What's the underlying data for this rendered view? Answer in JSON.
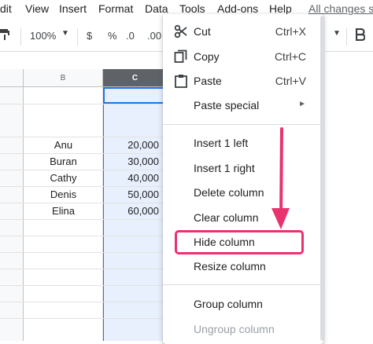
{
  "menubar": {
    "items": [
      "dit",
      "View",
      "Insert",
      "Format",
      "Data",
      "Tools",
      "Add-ons",
      "Help"
    ],
    "changes": "All changes s"
  },
  "toolbar": {
    "zoom": "100%",
    "currency": "$",
    "percent": "%",
    "dec_less": ".0",
    "dec_more": ".00"
  },
  "grid": {
    "columns": [
      "B",
      "C"
    ],
    "rows": [
      {
        "name": "Anu",
        "value": "20,000"
      },
      {
        "name": "Buran",
        "value": "30,000"
      },
      {
        "name": "Cathy",
        "value": "40,000"
      },
      {
        "name": "Denis",
        "value": "50,000"
      },
      {
        "name": "Elina",
        "value": "60,000"
      }
    ]
  },
  "context_menu": {
    "cut": {
      "label": "Cut",
      "shortcut": "Ctrl+X"
    },
    "copy": {
      "label": "Copy",
      "shortcut": "Ctrl+C"
    },
    "paste": {
      "label": "Paste",
      "shortcut": "Ctrl+V"
    },
    "paste_special": {
      "label": "Paste special"
    },
    "insert_left": {
      "label": "Insert 1 left"
    },
    "insert_right": {
      "label": "Insert 1 right"
    },
    "delete_column": {
      "label": "Delete column"
    },
    "clear_column": {
      "label": "Clear column"
    },
    "hide_column": {
      "label": "Hide column"
    },
    "resize_column": {
      "label": "Resize column"
    },
    "group_column": {
      "label": "Group column"
    },
    "ungroup_column": {
      "label": "Ungroup column"
    }
  },
  "colors": {
    "highlight": "#e8336f",
    "selection": "#1a73e8"
  }
}
